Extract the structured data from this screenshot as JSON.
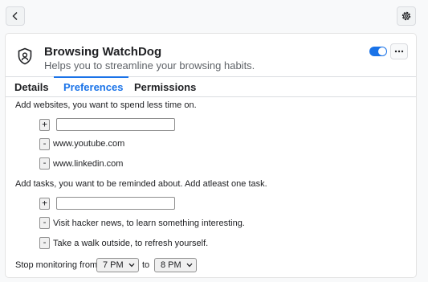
{
  "header": {
    "back_icon": "chevron-left-icon",
    "settings_icon": "gear-icon"
  },
  "extension": {
    "name": "Browsing WatchDog",
    "description": "Helps you to streamline your browsing habits.",
    "icon": "shield-person-icon",
    "enabled": true,
    "more_icon": "more-horizontal-icon"
  },
  "tabs": [
    {
      "label": "Details",
      "active": false
    },
    {
      "label": "Preferences",
      "active": true
    },
    {
      "label": "Permissions",
      "active": false
    }
  ],
  "preferences": {
    "websites_heading": "Add websites, you want to spend less time on.",
    "add_label": "+",
    "remove_label": "-",
    "website_input_value": "",
    "websites": [
      "www.youtube.com",
      "www.linkedin.com"
    ],
    "tasks_heading": "Add tasks, you want to be reminded about. Add atleast one task.",
    "task_input_value": "",
    "tasks": [
      "Visit hacker news, to learn something interesting.",
      "Take a walk outside, to refresh yourself."
    ],
    "monitoring_label": "Stop monitoring from",
    "from_value": "7 PM",
    "to_label": "to",
    "to_value": "8 PM"
  },
  "colors": {
    "accent": "#1a73e8",
    "text": "#202124",
    "muted": "#5f6368"
  }
}
